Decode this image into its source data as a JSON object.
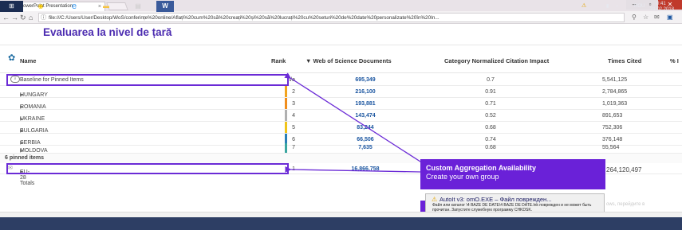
{
  "browser": {
    "tab_title": "PowerPoint Presentation",
    "tab_close": "×",
    "url": "file:///C:/Users/User/Desktop/WoS/conferințe%20online/Aflați%20cum%20să%20creați%20și%20să%20lucrați%20cu%20seturi%20de%20date%20personalizate%20în%20In...",
    "window_controls": {
      "minimize": "–",
      "maximize": "▫",
      "close": "✕"
    }
  },
  "page": {
    "heading": "Evaluarea la nivel de țară"
  },
  "table": {
    "headers": {
      "name": "Name",
      "rank": "Rank",
      "wos": "▼ Web of Science Documents",
      "cnci": "Category Normalized Citation Impact",
      "times_cited": "Times Cited",
      "pct": "% I"
    },
    "baseline": {
      "name": "Baseline for Pinned Items",
      "rank": "n/a",
      "wos": "695,349",
      "cnci": "0.7",
      "tc": "5,541,125"
    },
    "rows": [
      {
        "name": "HUNGARY",
        "rank": "2",
        "wos": "216,100",
        "cnci": "0.91",
        "tc": "2,784,865",
        "color": "#f2a41e"
      },
      {
        "name": "ROMANIA",
        "rank": "3",
        "wos": "193,881",
        "cnci": "0.71",
        "tc": "1,019,363",
        "color": "#f08d1c"
      },
      {
        "name": "UKRAINE",
        "rank": "4",
        "wos": "143,474",
        "cnci": "0.52",
        "tc": "891,653",
        "color": "#b0b0b0"
      },
      {
        "name": "BULGARIA",
        "rank": "5",
        "wos": "83,244",
        "cnci": "0.68",
        "tc": "752,306",
        "color": "#f0c419"
      },
      {
        "name": "SERBIA",
        "rank": "6",
        "wos": "66,506",
        "cnci": "0.74",
        "tc": "376,148",
        "color": "#2a7fb8"
      },
      {
        "name": "MOLDOVA",
        "rank": "7",
        "wos": "7,635",
        "cnci": "0.68",
        "tc": "55,564",
        "color": "#3aa6a0"
      }
    ],
    "pinned_label": "6 pinned items",
    "eu_row": {
      "name": "EU-28 Totals",
      "rank": "1",
      "wos": "16,866,758",
      "tc": "264,120,497"
    }
  },
  "callout": {
    "title": "Custom Aggregation Availability",
    "subtitle": "Create your own group"
  },
  "popup": {
    "title": "AutoIt v3: omO.EXE – Файл поврежден...",
    "body": "Файл или каталог \\4 BAZE DE DATE\\4 BAZE DE DATE.lnk поврежден и не может быть прочитан. Запустите служебную программу CHKDSK."
  },
  "ghost_text": "ows, перейдите в",
  "taskbar": {
    "lang": "ROU",
    "time": "0:41",
    "date": "21.02.2018"
  }
}
